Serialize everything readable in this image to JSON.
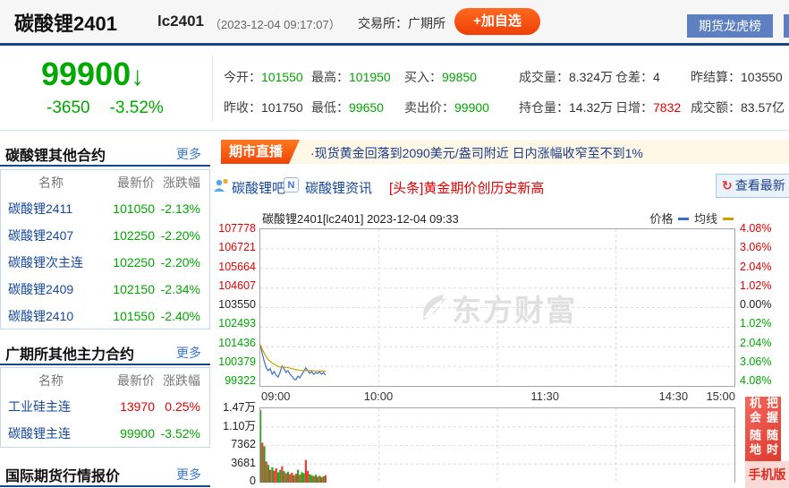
{
  "header": {
    "title": "碳酸锂2401",
    "code": "lc2401",
    "timestamp": "（2023-12-04 09:17:07）",
    "exchange": "交易所：广期所",
    "add_watchlist": "+加自选",
    "longhu_button": "期货龙虎榜"
  },
  "quote": {
    "price": "99900",
    "arrow": "↓",
    "change": "-3650",
    "change_pct": "-3.52%",
    "stats": [
      {
        "label": "今开：",
        "value": "101550",
        "color": "green"
      },
      {
        "label": "最高：",
        "value": "101950",
        "color": "green"
      },
      {
        "label": "买入：",
        "value": "99850",
        "color": "green"
      },
      {
        "label": "成交量：",
        "value": "8.324万",
        "color": "dark"
      },
      {
        "label": "仓差：",
        "value": "4",
        "color": "dark"
      },
      {
        "label": "昨结算：",
        "value": "103550",
        "color": "dark"
      },
      {
        "label": "昨收：",
        "value": "101750",
        "color": "dark"
      },
      {
        "label": "最低：",
        "value": "99650",
        "color": "green"
      },
      {
        "label": "卖出价：",
        "value": "99900",
        "color": "green"
      },
      {
        "label": "持仓量：",
        "value": "14.32万",
        "color": "dark"
      },
      {
        "label": "日增：",
        "value": "7832",
        "color": "red"
      },
      {
        "label": "成交额：",
        "value": "83.57亿",
        "color": "dark"
      }
    ]
  },
  "sidebar": {
    "sections": [
      {
        "title": "碳酸锂其他合约",
        "more": "更多",
        "columns": [
          "名称",
          "最新价",
          "涨跌幅"
        ],
        "rows": [
          {
            "name": "碳酸锂2411",
            "price": "101050",
            "pct": "-2.13%",
            "color": "green"
          },
          {
            "name": "碳酸锂2407",
            "price": "102250",
            "pct": "-2.20%",
            "color": "green"
          },
          {
            "name": "碳酸锂次主连",
            "price": "102250",
            "pct": "-2.20%",
            "color": "green"
          },
          {
            "name": "碳酸锂2409",
            "price": "102150",
            "pct": "-2.34%",
            "color": "green"
          },
          {
            "name": "碳酸锂2410",
            "price": "101550",
            "pct": "-2.40%",
            "color": "green"
          }
        ]
      },
      {
        "title": "广期所其他主力合约",
        "more": "更多",
        "columns": [
          "名称",
          "最新价",
          "涨跌幅"
        ],
        "rows": [
          {
            "name": "工业硅主连",
            "price": "13970",
            "pct": "0.25%",
            "color": "red"
          },
          {
            "name": "碳酸锂主连",
            "price": "99900",
            "pct": "-3.52%",
            "color": "green"
          }
        ]
      },
      {
        "title": "国际期货行情报价",
        "more": "更多"
      }
    ]
  },
  "ticker": {
    "badge": "期市直播",
    "text": "·现货黄金回落到2090美元/盎司附近 日内涨幅收窄至不到1%"
  },
  "tabs": {
    "bar": "碳酸锂吧",
    "news": "碳酸锂资讯",
    "news_icon": "N",
    "headline": "[头条]黄金期价创历史新高",
    "refresh": "查看最新",
    "refresh_icon": "↻"
  },
  "chart": {
    "title": "碳酸锂2401[lc2401] 2023-12-04 09:33",
    "legend_price": "价格",
    "legend_ma": "均线",
    "watermark": "东方财富",
    "left_axis": [
      "107778",
      "106721",
      "105664",
      "104607",
      "103550",
      "102493",
      "101436",
      "100379",
      "99322"
    ],
    "right_axis": [
      "4.08%",
      "3.06%",
      "2.04%",
      "1.02%",
      "0.00%",
      "1.02%",
      "2.04%",
      "3.06%",
      "4.08%"
    ],
    "x_labels": [
      "09:00",
      "10:00",
      "11:30",
      "14:30",
      "15:00"
    ],
    "volume_axis": [
      "1.47万",
      "1.10万",
      "7362",
      "3681",
      "0"
    ]
  },
  "ad": {
    "line_right": "把握机会",
    "line_left": "随时随地",
    "footer": "手机版"
  },
  "colors": {
    "up": "#e60000",
    "down": "#00a800",
    "price_line": "#3b6ccb",
    "ma_line": "#c6a300",
    "grid": "#dcdcdc",
    "vol_up": "#f03b3b",
    "vol_down": "#1da81d"
  },
  "chart_data": {
    "type": "line",
    "title": "碳酸锂2401[lc2401] 2023-12-04 09:33",
    "x_total_minutes": 240,
    "x_tick_labels": [
      "09:00",
      "10:00",
      "11:30",
      "14:30",
      "15:00"
    ],
    "ylim": [
      99322,
      107778
    ],
    "y_left_ticks": [
      107778,
      106721,
      105664,
      104607,
      103550,
      102493,
      101436,
      100379,
      99322
    ],
    "y_right_ticks": [
      "4.08%",
      "3.06%",
      "2.04%",
      "1.02%",
      "0.00%",
      "1.02%",
      "2.04%",
      "3.06%",
      "4.08%"
    ],
    "prev_settle": 103550,
    "grid": true,
    "legend_position": "top-right",
    "series": [
      {
        "name": "价格",
        "color": "#3b6ccb",
        "values": [
          101550,
          101050,
          100650,
          100300,
          100150,
          100250,
          99950,
          100100,
          99900,
          99800,
          100050,
          100400,
          100250,
          100050,
          100150,
          99950,
          99850,
          99700,
          99650,
          99850,
          99750,
          99950,
          100100,
          100300,
          100150,
          100000,
          100100,
          99950,
          100050,
          100000,
          100100,
          99950,
          100050,
          99900
        ]
      },
      {
        "name": "均线",
        "color": "#c6a300",
        "values": [
          101550,
          101300,
          101083,
          100888,
          100740,
          100658,
          100557,
          100500,
          100433,
          100370,
          100341,
          100346,
          100338,
          100318,
          100307,
          100284,
          100259,
          100228,
          100197,
          100180,
          100160,
          100150,
          100148,
          100154,
          100154,
          100148,
          100146,
          100139,
          100136,
          100132,
          100131,
          100125,
          100123,
          100116
        ]
      }
    ],
    "volume": {
      "ylim": [
        0,
        14724
      ],
      "ticks": [
        "1.47万",
        "1.10万",
        "7362",
        "3681",
        "0"
      ],
      "values": [
        14700,
        8100,
        7400,
        4300,
        3600,
        2600,
        3100,
        2400,
        2900,
        2100,
        2600,
        3300,
        2300,
        1900,
        2200,
        1700,
        2000,
        1500,
        1800,
        2600,
        1600,
        2100,
        1900,
        4600,
        2400,
        1700,
        1500,
        1300,
        1600,
        1200,
        1400,
        1100,
        1300,
        1500
      ],
      "colors": [
        "g",
        "r",
        "g",
        "r",
        "g",
        "r",
        "g",
        "r",
        "r",
        "g",
        "g",
        "r",
        "g",
        "r",
        "g",
        "r",
        "r",
        "g",
        "r",
        "g",
        "r",
        "g",
        "g",
        "r",
        "r",
        "g",
        "g",
        "r",
        "g",
        "r",
        "g",
        "r",
        "g",
        "r"
      ]
    }
  }
}
